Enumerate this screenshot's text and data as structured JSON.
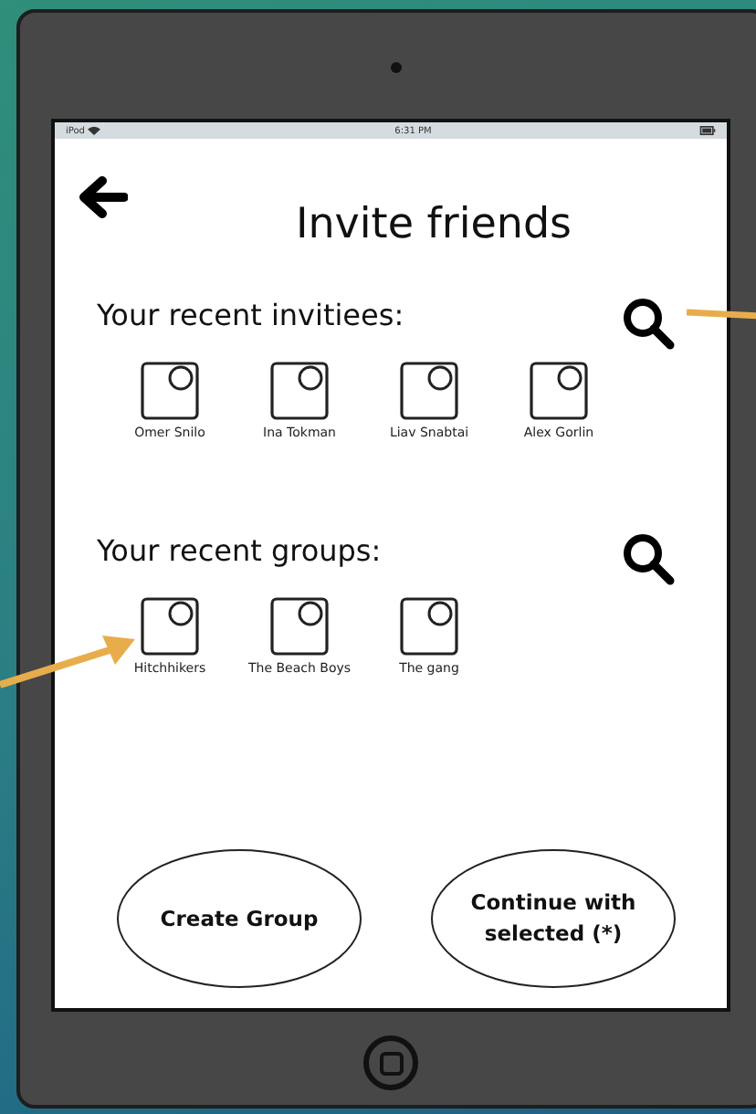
{
  "status_bar": {
    "carrier": "iPod",
    "time": "6:31 PM"
  },
  "title": "Invite friends",
  "sections": [
    {
      "heading": "Your recent invitiees:",
      "items": [
        {
          "name": "Omer Snilo"
        },
        {
          "name": "Ina Tokman"
        },
        {
          "name": "Liav Snabtai"
        },
        {
          "name": "Alex Gorlin"
        }
      ]
    },
    {
      "heading": "Your recent groups:",
      "items": [
        {
          "name": "Hitchhikers"
        },
        {
          "name": "The Beach Boys"
        },
        {
          "name": "The gang"
        }
      ]
    }
  ],
  "buttons": [
    "Create Group",
    "Continue with selected (*)"
  ]
}
